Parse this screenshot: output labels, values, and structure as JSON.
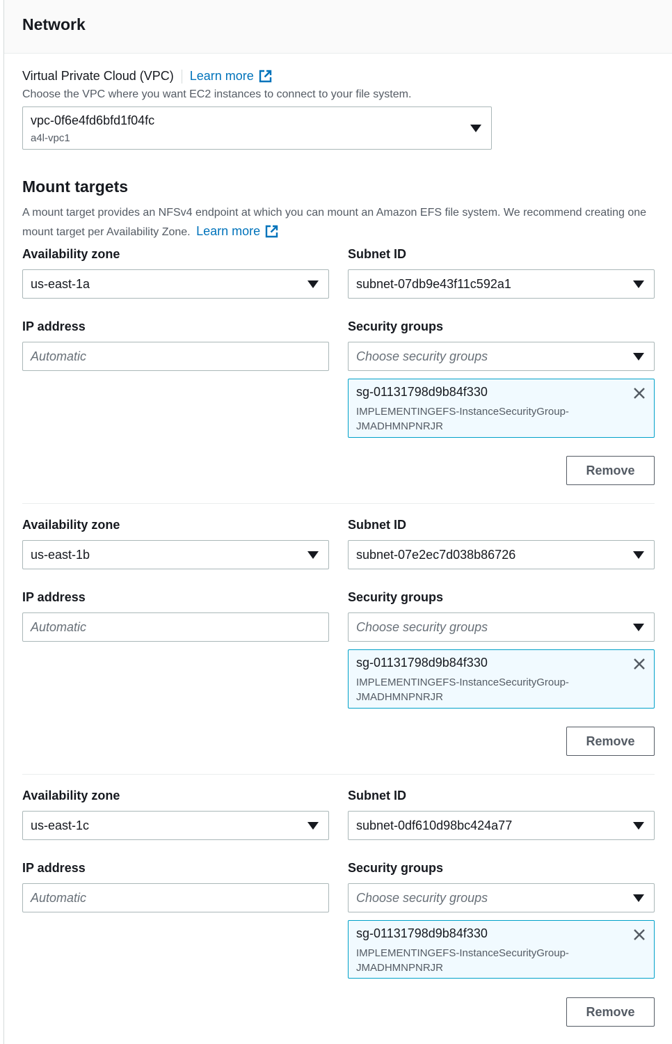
{
  "section_title": "Network",
  "vpc": {
    "label": "Virtual Private Cloud (VPC)",
    "learn_more": "Learn more",
    "description": "Choose the VPC where you want EC2 instances to connect to your file system.",
    "selected_id": "vpc-0f6e4fd6bfd1f04fc",
    "selected_name": "a4l-vpc1"
  },
  "mount_targets": {
    "title": "Mount targets",
    "description": "A mount target provides an NFSv4 endpoint at which you can mount an Amazon EFS file system. We recommend creating one mount target per Availability Zone.",
    "learn_more": "Learn more",
    "labels": {
      "az": "Availability zone",
      "subnet": "Subnet ID",
      "ip": "IP address",
      "sg": "Security groups",
      "ip_placeholder": "Automatic",
      "sg_placeholder": "Choose security groups",
      "remove": "Remove"
    },
    "targets": [
      {
        "az": "us-east-1a",
        "subnet": "subnet-07db9e43f11c592a1",
        "sg_id": "sg-01131798d9b84f330",
        "sg_name": "IMPLEMENTINGEFS-InstanceSecurityGroup-JMADHMNPNRJR"
      },
      {
        "az": "us-east-1b",
        "subnet": "subnet-07e2ec7d038b86726",
        "sg_id": "sg-01131798d9b84f330",
        "sg_name": "IMPLEMENTINGEFS-InstanceSecurityGroup-JMADHMNPNRJR"
      },
      {
        "az": "us-east-1c",
        "subnet": "subnet-0df610d98bc424a77",
        "sg_id": "sg-01131798d9b84f330",
        "sg_name": "IMPLEMENTINGEFS-InstanceSecurityGroup-JMADHMNPNRJR"
      }
    ]
  },
  "colors": {
    "link": "#0073bb",
    "token_border": "#00a1c9",
    "token_bg": "#f1faff"
  }
}
